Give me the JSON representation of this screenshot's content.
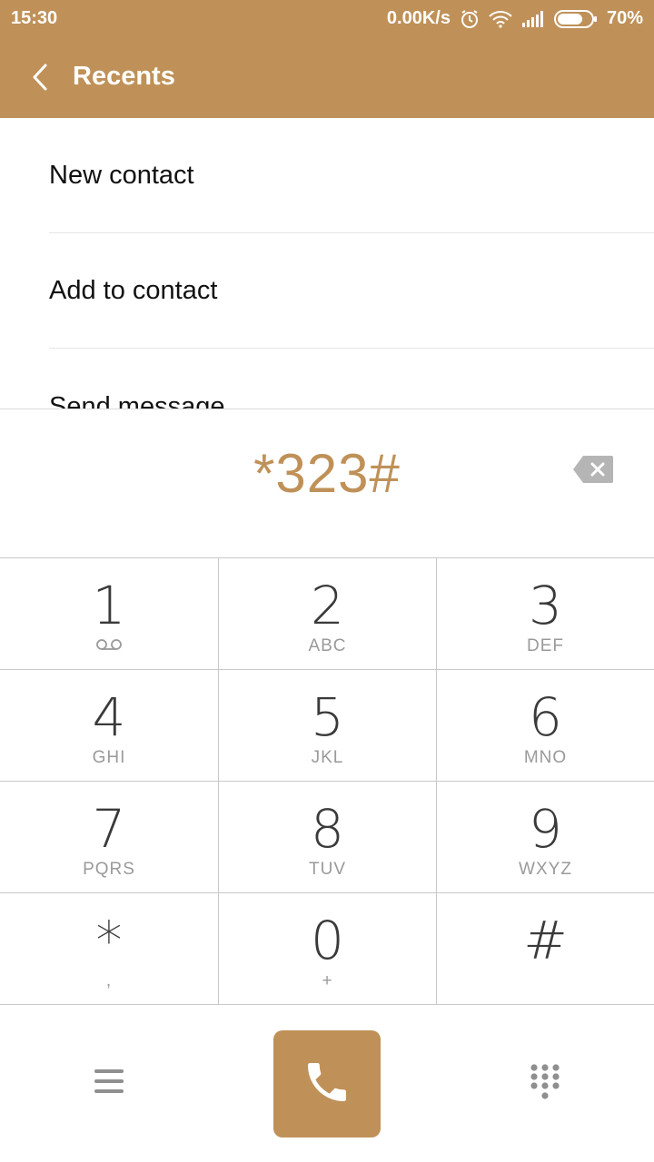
{
  "status": {
    "time": "15:30",
    "speed": "0.00K/s",
    "battery": "70%"
  },
  "header": {
    "title": "Recents",
    "back_icon": "chevron-left-icon"
  },
  "menu": {
    "items": [
      "New contact",
      "Add to contact",
      "Send message"
    ]
  },
  "dialer": {
    "number": "*323#"
  },
  "keypad": {
    "keys": [
      {
        "digit": "1",
        "letters": ""
      },
      {
        "digit": "2",
        "letters": "ABC"
      },
      {
        "digit": "3",
        "letters": "DEF"
      },
      {
        "digit": "4",
        "letters": "GHI"
      },
      {
        "digit": "5",
        "letters": "JKL"
      },
      {
        "digit": "6",
        "letters": "MNO"
      },
      {
        "digit": "7",
        "letters": "PQRS"
      },
      {
        "digit": "8",
        "letters": "TUV"
      },
      {
        "digit": "9",
        "letters": "WXYZ"
      },
      {
        "digit": "*",
        "letters": ","
      },
      {
        "digit": "0",
        "letters": "+"
      },
      {
        "digit": "#",
        "letters": ""
      }
    ]
  },
  "colors": {
    "accent": "#bf9158",
    "digit": "#3a3a3a",
    "letters": "#9a9a9a"
  }
}
